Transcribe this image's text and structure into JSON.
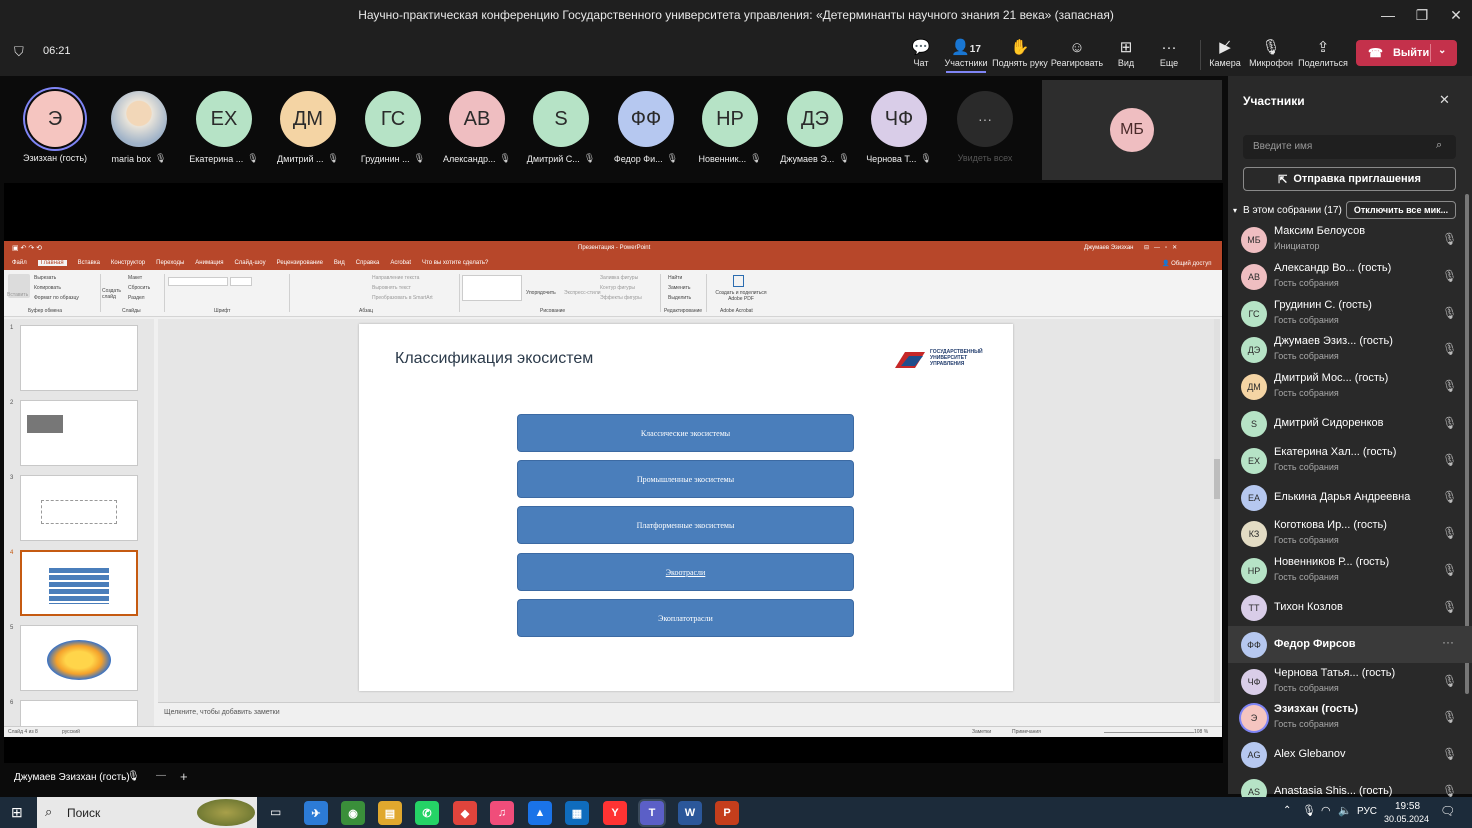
{
  "window": {
    "title": "Научно-практическая конференцию Государственного университета управления: «Детерминанты научного знания 21 века» (запасная)"
  },
  "toolbar": {
    "timer": "06:21",
    "chat": "Чат",
    "participants": "Участники",
    "participants_count": "17",
    "raise_hand": "Поднять руку",
    "react": "Реагировать",
    "view": "Вид",
    "more": "Еще",
    "camera": "Камера",
    "mic": "Микрофон",
    "share": "Поделиться",
    "leave": "Выйти"
  },
  "strip": {
    "participants": [
      {
        "initials": "Э",
        "name": "Эзизхан (гость)",
        "color": "#f5c5c0"
      },
      {
        "initials": "",
        "name": "maria box",
        "color": "#d9cfc2"
      },
      {
        "initials": "ЕХ",
        "name": "Екатерина ...",
        "color": "#b6e3c6"
      },
      {
        "initials": "ДМ",
        "name": "Дмитрий ...",
        "color": "#f4d4a4"
      },
      {
        "initials": "ГС",
        "name": "Грудинин ...",
        "color": "#b6e3c6"
      },
      {
        "initials": "АВ",
        "name": "Александр...",
        "color": "#efbec1"
      },
      {
        "initials": "S",
        "name": "Дмитрий С...",
        "color": "#b6e3c6"
      },
      {
        "initials": "ФФ",
        "name": "Федор Фи...",
        "color": "#b6c8f0"
      },
      {
        "initials": "НР",
        "name": "Новенник...",
        "color": "#b6e3c6"
      },
      {
        "initials": "ДЭ",
        "name": "Джумаев Э...",
        "color": "#b6e3c6"
      },
      {
        "initials": "ЧФ",
        "name": "Чернова Т...",
        "color": "#d9cde8"
      }
    ],
    "more_label": "Увидеть всех",
    "more_glyph": "···",
    "self_initials": "МБ"
  },
  "ppt": {
    "title": "Презентация - PowerPoint",
    "user": "Джумаев Эзизхан",
    "tabs": [
      "Файл",
      "Главная",
      "Вставка",
      "Конструктор",
      "Переходы",
      "Анимация",
      "Слайд-шоу",
      "Рецензирование",
      "Вид",
      "Справка",
      "Acrobat",
      "Что вы хотите сделать?"
    ],
    "share": "Общий доступ",
    "ribbon": {
      "clipboard": {
        "paste": "Вставить",
        "cut": "Вырезать",
        "copy": "Копировать",
        "format": "Формат по образцу",
        "group": "Буфер обмена"
      },
      "slides": {
        "new": "Создать слайд",
        "layout": "Макет",
        "reset": "Сбросить",
        "section": "Раздел",
        "group": "Слайды"
      },
      "font_group": "Шрифт",
      "paragraph": {
        "dir": "Направление текста",
        "align": "Выровнять текст",
        "smartart": "Преобразовать в SmartArt",
        "group": "Абзац"
      },
      "drawing": {
        "arrange": "Упорядочить",
        "quick": "Экспресс-стили",
        "fill": "Заливка фигуры",
        "outline": "Контур фигуры",
        "effects": "Эффекты фигуры",
        "group": "Рисование"
      },
      "editing": {
        "find": "Найти",
        "replace": "Заменить",
        "select": "Выделить",
        "group": "Редактирование"
      },
      "acrobat": {
        "create": "Создать и поделиться Adobe PDF",
        "group": "Adobe Acrobat"
      }
    },
    "thumb_numbers": [
      "1",
      "2",
      "3",
      "4",
      "5",
      "6"
    ],
    "slide": {
      "title": "Классификация экосистем",
      "logo_text": "ГОСУДАРСТВЕННЫЙ УНИВЕРСИТЕТ УПРАВЛЕНИЯ",
      "boxes": [
        "Классические экосистемы",
        "Промышленные экосистемы",
        "Платформенные экосистемы",
        "Экоотрасли",
        "Экоплатотрасли"
      ]
    },
    "notes": "Щелкните, чтобы добавить заметки",
    "status": {
      "slide": "Слайд 4 из 8",
      "lang": "русский",
      "notes": "Заметки",
      "comments": "Примечания",
      "zoom": "108 %"
    }
  },
  "panel": {
    "title": "Участники",
    "search_placeholder": "Введите имя",
    "invite": "Отправка приглашения",
    "section": "В этом собрании (17)",
    "mute_all": "Отключить все мик...",
    "people": [
      {
        "initials": "МБ",
        "name": "Максим Белоусов",
        "sub": "Инициатор",
        "color": "#efbec1"
      },
      {
        "initials": "АВ",
        "name": "Александр Во... (гость)",
        "sub": "Гость собрания",
        "color": "#efbec1"
      },
      {
        "initials": "ГС",
        "name": "Грудинин С. (гость)",
        "sub": "Гость собрания",
        "color": "#b6e3c6"
      },
      {
        "initials": "ДЭ",
        "name": "Джумаев Эзиз... (гость)",
        "sub": "Гость собрания",
        "color": "#b6e3c6"
      },
      {
        "initials": "ДМ",
        "name": "Дмитрий Мос... (гость)",
        "sub": "Гость собрания",
        "color": "#f4d4a4"
      },
      {
        "initials": "S",
        "name": "Дмитрий Сидоренков",
        "sub": "",
        "color": "#b6e3c6"
      },
      {
        "initials": "ЕХ",
        "name": "Екатерина Хал... (гость)",
        "sub": "Гость собрания",
        "color": "#b6e3c6"
      },
      {
        "initials": "ЕА",
        "name": "Елькина Дарья Андреевна",
        "sub": "",
        "color": "#b6c8f0"
      },
      {
        "initials": "КЗ",
        "name": "Коготкова Ир... (гость)",
        "sub": "Гость собрания",
        "color": "#e3dcc4"
      },
      {
        "initials": "НР",
        "name": "Новенников Р... (гость)",
        "sub": "Гость собрания",
        "color": "#b6e3c6"
      },
      {
        "initials": "ТТ",
        "name": "Тихон Козлов",
        "sub": "",
        "color": "#d9cde8"
      },
      {
        "initials": "ФФ",
        "name": "Федор Фирсов",
        "sub": "",
        "color": "#b6c8f0"
      },
      {
        "initials": "ЧФ",
        "name": "Чернова Татья... (гость)",
        "sub": "Гость собрания",
        "color": "#d9cde8"
      },
      {
        "initials": "Э",
        "name": "Эзизхан (гость)",
        "sub": "Гость собрания",
        "color": "#f5c5c0"
      },
      {
        "initials": "AG",
        "name": "Alex Glebanov",
        "sub": "",
        "color": "#b6c8f0"
      },
      {
        "initials": "AS",
        "name": "Anastasia Shis... (гость)",
        "sub": "",
        "color": "#b6e3c6"
      }
    ],
    "more_glyph": "···"
  },
  "own": {
    "name": "Джумаев Эзизхан (гость)"
  },
  "taskbar": {
    "search": "Поиск",
    "lang": "РУС",
    "time": "19:58",
    "date": "30.05.2024"
  }
}
